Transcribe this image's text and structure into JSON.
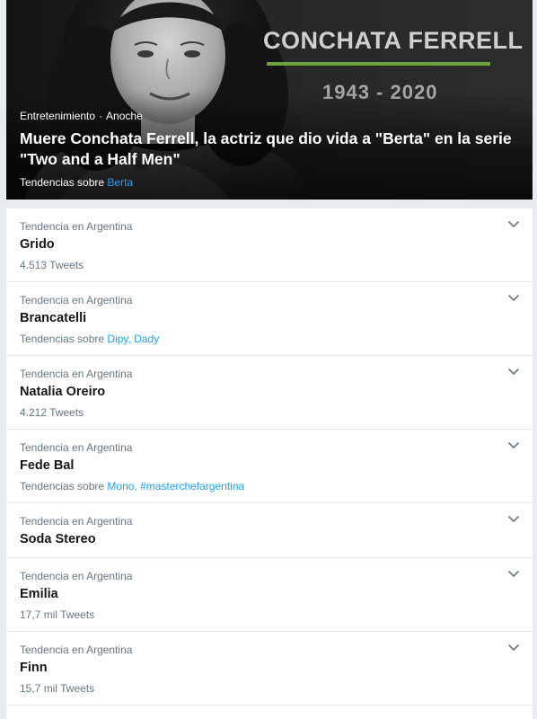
{
  "hero": {
    "name_overlay": "CONCHATA FERRELL",
    "years_overlay": "1943 - 2020",
    "category": "Entretenimiento",
    "separator": "·",
    "time": "Anoche",
    "headline": "Muere Conchata Ferrell, la actriz que dio vida a \"Berta\" en la serie \"Two and a Half Men\"",
    "related_prefix": "Tendencias sobre",
    "related_links": "Berta",
    "accent_color": "#6da33a"
  },
  "trends": [
    {
      "context": "Tendencia en Argentina",
      "name": "Grido",
      "meta": "4.513 Tweets"
    },
    {
      "context": "Tendencia en Argentina",
      "name": "Brancatelli",
      "related_prefix": "Tendencias sobre",
      "related_links": "Dipy, Dady"
    },
    {
      "context": "Tendencia en Argentina",
      "name": "Natalia Oreiro",
      "meta": "4.212 Tweets"
    },
    {
      "context": "Tendencia en Argentina",
      "name": "Fede Bal",
      "related_prefix": "Tendencias sobre",
      "related_links": "Mono, #masterchefargentina"
    },
    {
      "context": "Tendencia en Argentina",
      "name": "Soda Stereo"
    },
    {
      "context": "Tendencia en Argentina",
      "name": "Emilia",
      "meta": "17,7 mil Tweets"
    },
    {
      "context": "Tendencia en Argentina",
      "name": "Finn",
      "meta": "15,7 mil Tweets"
    }
  ],
  "icons": {
    "trend_menu": "chevron-down-icon"
  },
  "colors": {
    "link": "#1da1f2",
    "secondary_text": "#657786",
    "divider": "#e6ecf0"
  }
}
